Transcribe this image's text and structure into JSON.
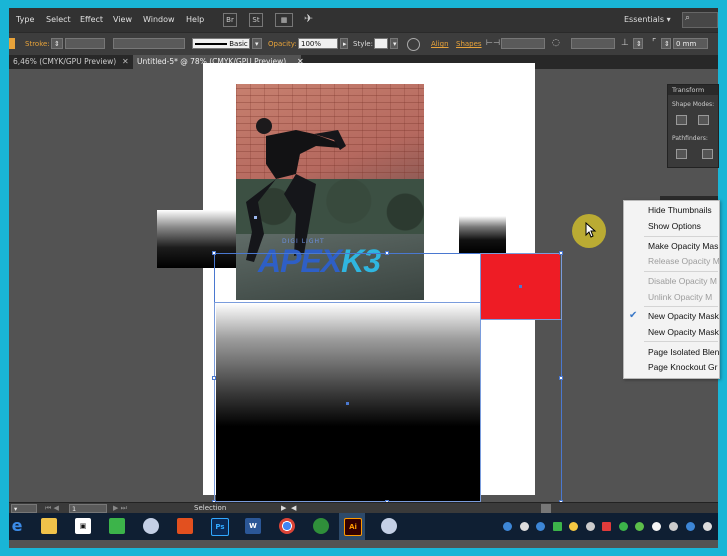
{
  "menubar": {
    "items": [
      "Type",
      "Select",
      "Effect",
      "View",
      "Window",
      "Help"
    ],
    "workspace": "Essentials"
  },
  "controlbar": {
    "stroke_label": "Stroke:",
    "brush_value": "Basic",
    "opacity_label": "Opacity:",
    "opacity_value": "100%",
    "style_label": "Style:",
    "align_label": "Align",
    "shapes_label": "Shapes",
    "measure_value": "0 mm"
  },
  "tabs": [
    {
      "label": "6,46% (CMYK/GPU Preview)",
      "active": false
    },
    {
      "label": "Untitled-5* @ 78% (CMYK/GPU Preview)",
      "active": true
    }
  ],
  "artwork": {
    "tagline": "DIGI LIGHT",
    "logo_part1": "APEX",
    "logo_part2": "K3"
  },
  "transform_panel": {
    "title": "Transform",
    "shape_modes_label": "Shape Modes:",
    "pathfinders_label": "Pathfinders:"
  },
  "context_menu": {
    "items": [
      {
        "label": "Hide Thumbnails",
        "disabled": false
      },
      {
        "label": "Show Options",
        "disabled": false
      },
      {
        "label": "Make Opacity Mas",
        "disabled": false
      },
      {
        "label": "Release Opacity M",
        "disabled": true
      },
      {
        "label": "Disable Opacity M",
        "disabled": true
      },
      {
        "label": "Unlink Opacity M",
        "disabled": true
      },
      {
        "label": "New Opacity Mask",
        "disabled": false,
        "checked": true
      },
      {
        "label": "New Opacity Mask",
        "disabled": false
      },
      {
        "label": "Page Isolated Blen",
        "disabled": false
      },
      {
        "label": "Page Knockout Gr",
        "disabled": false
      }
    ]
  },
  "statusbar": {
    "page_value": "1",
    "tool_label": "Selection"
  },
  "taskbar": {
    "icons": [
      "Edge",
      "File Explorer",
      "Store",
      "Camtasia",
      "Browser",
      "Office",
      "Photoshop",
      "Word",
      "Chrome",
      "Camtasia Recorder",
      "Illustrator",
      "Browser 2"
    ],
    "ps_label": "Ps",
    "word_label": "W",
    "ai_label": "Ai"
  },
  "colors": {
    "accent_blue": "#4a78d0",
    "red_square": "#ee1c25",
    "frame_cyan": "#19b5d6"
  }
}
